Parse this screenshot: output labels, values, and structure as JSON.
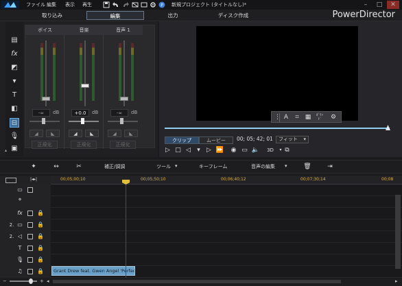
{
  "title_bar": {
    "menus": [
      "ファイル",
      "編集",
      "表示",
      "再生"
    ],
    "project_title": "新規プロジェクト (タイトルなし)*",
    "window_buttons": [
      "minimize-icon",
      "maximize-icon",
      "close-icon"
    ]
  },
  "modes": {
    "tabs": [
      "取り込み",
      "編集",
      "出力",
      "ディスク作成"
    ],
    "active": "編集",
    "brand": "PowerDirector"
  },
  "mixer": {
    "channels": [
      {
        "name": "ボイス",
        "db": "-∞",
        "unit": "dB",
        "normalize": "正規化"
      },
      {
        "name": "音楽",
        "db": "+0.0",
        "unit": "dB",
        "normalize": "正規化"
      },
      {
        "name": "音声 1",
        "db": "-∞",
        "unit": "dB",
        "normalize": "正規化"
      }
    ]
  },
  "preview": {
    "mode_clip": "クリップ",
    "mode_movie": "ムービー",
    "timecode": "00; 05; 42; 01",
    "fit": "フィット",
    "threeD": "3D",
    "overlay_icons": [
      "text-icon",
      "crop-icon",
      "grid-icon",
      "zoom-toggle-icon",
      "settings-icon"
    ],
    "overlay_zoom_label": "ｶﾞﾘｯﾄﾞ"
  },
  "toolbar": {
    "correct_label": "補正/調調",
    "tools_label": "ツール",
    "keyframe_label": "キーフレーム",
    "audio_edit_label": "音声の編集"
  },
  "ruler": {
    "ticks": [
      "00;05;00;10",
      "00;05;50;10",
      "00;06;40;12",
      "00;07;30;14",
      "00;08"
    ]
  },
  "clip": {
    "label": "Grant Drew feat. Gwen Angel 'Perfect'"
  }
}
